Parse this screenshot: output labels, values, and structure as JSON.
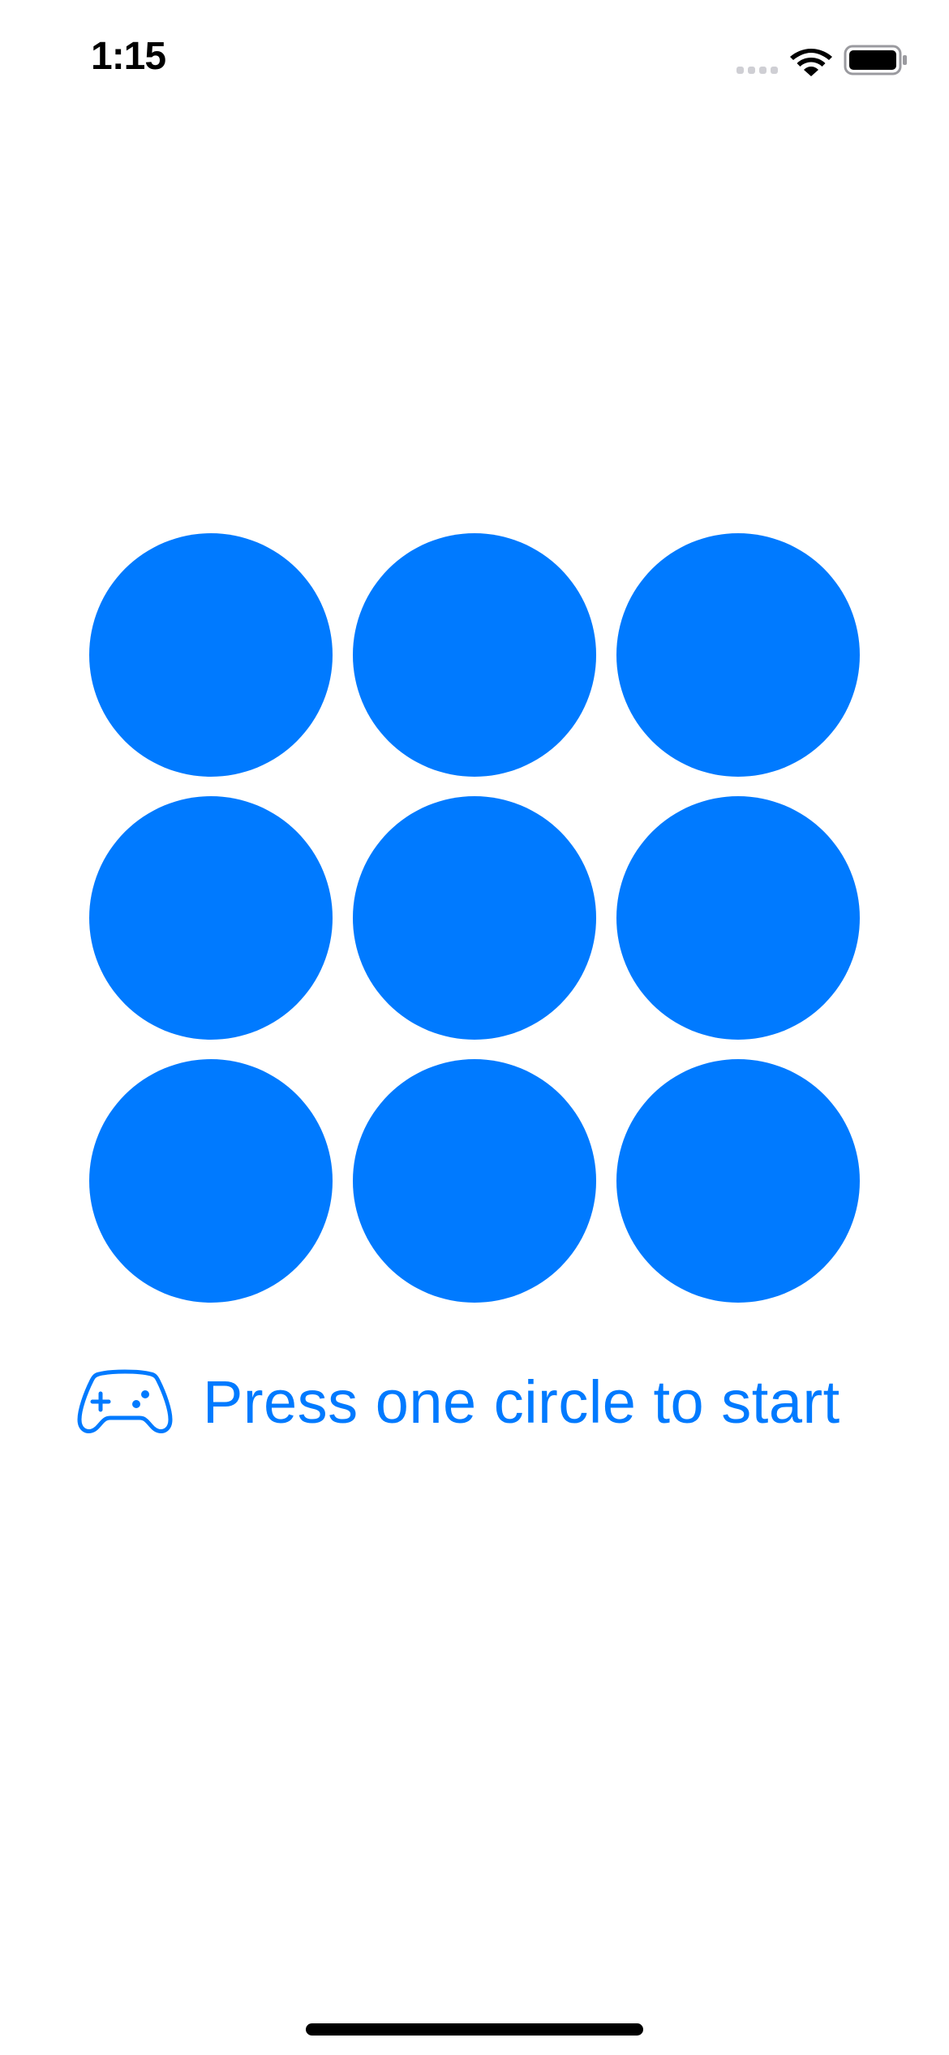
{
  "status_bar": {
    "time": "1:15",
    "wifi_icon": "wifi-icon",
    "battery_icon": "battery-icon"
  },
  "colors": {
    "accent": "#007aff",
    "background": "#ffffff",
    "text_primary": "#000000"
  },
  "game": {
    "circles": [
      {
        "id": 1
      },
      {
        "id": 2
      },
      {
        "id": 3
      },
      {
        "id": 4
      },
      {
        "id": 5
      },
      {
        "id": 6
      },
      {
        "id": 7
      },
      {
        "id": 8
      },
      {
        "id": 9
      }
    ]
  },
  "prompt": {
    "icon": "gamecontroller-icon",
    "text": "Press one circle to start"
  }
}
